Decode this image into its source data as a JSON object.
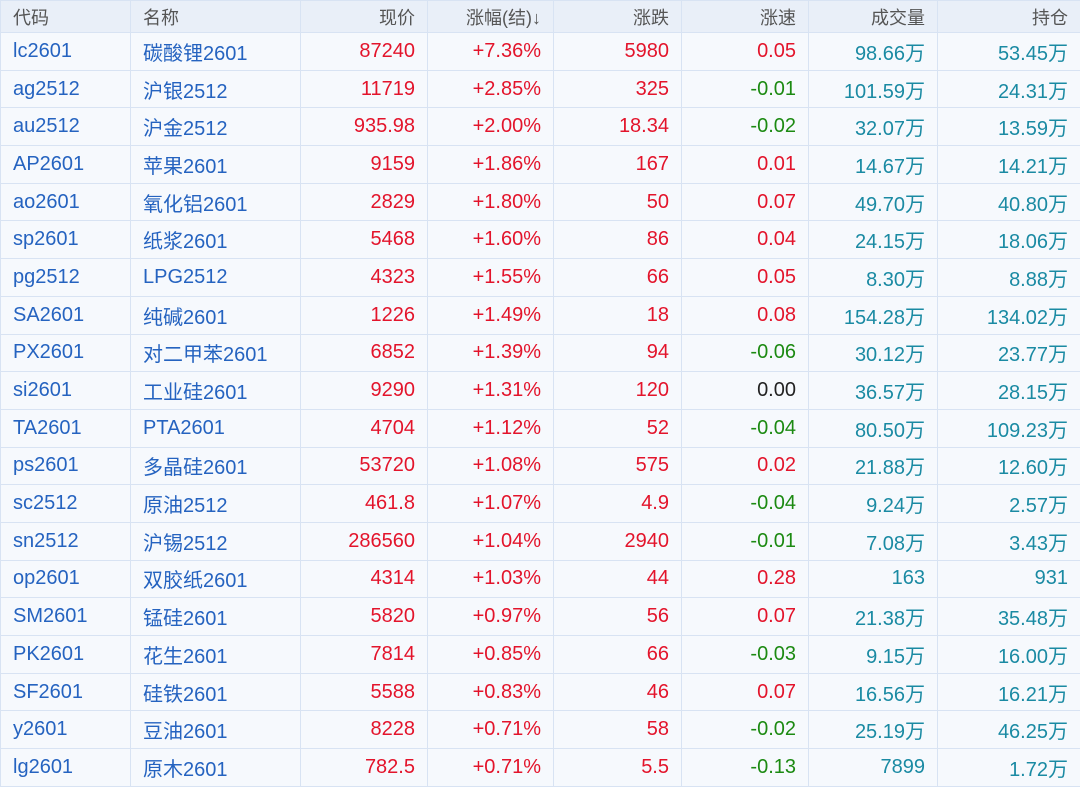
{
  "headers": [
    "代码",
    "名称",
    "现价",
    "涨幅(结)↓",
    "涨跌",
    "涨速",
    "成交量",
    "持仓"
  ],
  "rows": [
    [
      "lc2601",
      "碳酸锂2601",
      "87240",
      "+7.36%",
      "5980",
      "0.05",
      "98.66万",
      "53.45万"
    ],
    [
      "ag2512",
      "沪银2512",
      "11719",
      "+2.85%",
      "325",
      "-0.01",
      "101.59万",
      "24.31万"
    ],
    [
      "au2512",
      "沪金2512",
      "935.98",
      "+2.00%",
      "18.34",
      "-0.02",
      "32.07万",
      "13.59万"
    ],
    [
      "AP2601",
      "苹果2601",
      "9159",
      "+1.86%",
      "167",
      "0.01",
      "14.67万",
      "14.21万"
    ],
    [
      "ao2601",
      "氧化铝2601",
      "2829",
      "+1.80%",
      "50",
      "0.07",
      "49.70万",
      "40.80万"
    ],
    [
      "sp2601",
      "纸浆2601",
      "5468",
      "+1.60%",
      "86",
      "0.04",
      "24.15万",
      "18.06万"
    ],
    [
      "pg2512",
      "LPG2512",
      "4323",
      "+1.55%",
      "66",
      "0.05",
      "8.30万",
      "8.88万"
    ],
    [
      "SA2601",
      "纯碱2601",
      "1226",
      "+1.49%",
      "18",
      "0.08",
      "154.28万",
      "134.02万"
    ],
    [
      "PX2601",
      "对二甲苯2601",
      "6852",
      "+1.39%",
      "94",
      "-0.06",
      "30.12万",
      "23.77万"
    ],
    [
      "si2601",
      "工业硅2601",
      "9290",
      "+1.31%",
      "120",
      "0.00",
      "36.57万",
      "28.15万"
    ],
    [
      "TA2601",
      "PTA2601",
      "4704",
      "+1.12%",
      "52",
      "-0.04",
      "80.50万",
      "109.23万"
    ],
    [
      "ps2601",
      "多晶硅2601",
      "53720",
      "+1.08%",
      "575",
      "0.02",
      "21.88万",
      "12.60万"
    ],
    [
      "sc2512",
      "原油2512",
      "461.8",
      "+1.07%",
      "4.9",
      "-0.04",
      "9.24万",
      "2.57万"
    ],
    [
      "sn2512",
      "沪锡2512",
      "286560",
      "+1.04%",
      "2940",
      "-0.01",
      "7.08万",
      "3.43万"
    ],
    [
      "op2601",
      "双胶纸2601",
      "4314",
      "+1.03%",
      "44",
      "0.28",
      "163",
      "931"
    ],
    [
      "SM2601",
      "锰硅2601",
      "5820",
      "+0.97%",
      "56",
      "0.07",
      "21.38万",
      "35.48万"
    ],
    [
      "PK2601",
      "花生2601",
      "7814",
      "+0.85%",
      "66",
      "-0.03",
      "9.15万",
      "16.00万"
    ],
    [
      "SF2601",
      "硅铁2601",
      "5588",
      "+0.83%",
      "46",
      "0.07",
      "16.56万",
      "16.21万"
    ],
    [
      "y2601",
      "豆油2601",
      "8228",
      "+0.71%",
      "58",
      "-0.02",
      "25.19万",
      "46.25万"
    ],
    [
      "lg2601",
      "原木2601",
      "782.5",
      "+0.71%",
      "5.5",
      "-0.13",
      "7899",
      "1.72万"
    ]
  ]
}
